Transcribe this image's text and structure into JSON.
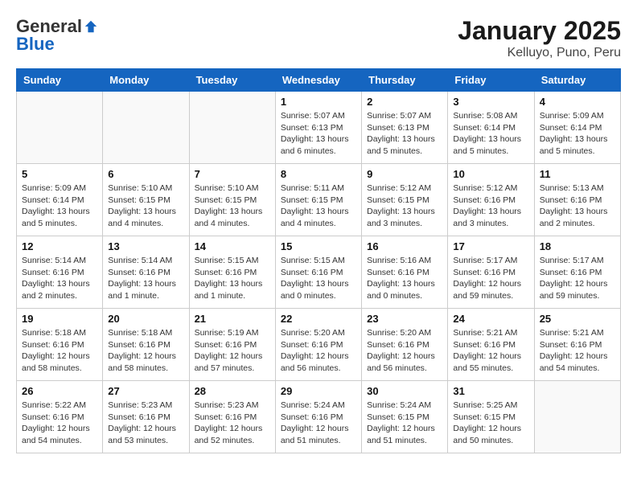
{
  "header": {
    "logo_general": "General",
    "logo_blue": "Blue",
    "month_title": "January 2025",
    "location": "Kelluyo, Puno, Peru"
  },
  "weekdays": [
    "Sunday",
    "Monday",
    "Tuesday",
    "Wednesday",
    "Thursday",
    "Friday",
    "Saturday"
  ],
  "weeks": [
    [
      {
        "day": "",
        "info": ""
      },
      {
        "day": "",
        "info": ""
      },
      {
        "day": "",
        "info": ""
      },
      {
        "day": "1",
        "info": "Sunrise: 5:07 AM\nSunset: 6:13 PM\nDaylight: 13 hours\nand 6 minutes."
      },
      {
        "day": "2",
        "info": "Sunrise: 5:07 AM\nSunset: 6:13 PM\nDaylight: 13 hours\nand 5 minutes."
      },
      {
        "day": "3",
        "info": "Sunrise: 5:08 AM\nSunset: 6:14 PM\nDaylight: 13 hours\nand 5 minutes."
      },
      {
        "day": "4",
        "info": "Sunrise: 5:09 AM\nSunset: 6:14 PM\nDaylight: 13 hours\nand 5 minutes."
      }
    ],
    [
      {
        "day": "5",
        "info": "Sunrise: 5:09 AM\nSunset: 6:14 PM\nDaylight: 13 hours\nand 5 minutes."
      },
      {
        "day": "6",
        "info": "Sunrise: 5:10 AM\nSunset: 6:15 PM\nDaylight: 13 hours\nand 4 minutes."
      },
      {
        "day": "7",
        "info": "Sunrise: 5:10 AM\nSunset: 6:15 PM\nDaylight: 13 hours\nand 4 minutes."
      },
      {
        "day": "8",
        "info": "Sunrise: 5:11 AM\nSunset: 6:15 PM\nDaylight: 13 hours\nand 4 minutes."
      },
      {
        "day": "9",
        "info": "Sunrise: 5:12 AM\nSunset: 6:15 PM\nDaylight: 13 hours\nand 3 minutes."
      },
      {
        "day": "10",
        "info": "Sunrise: 5:12 AM\nSunset: 6:16 PM\nDaylight: 13 hours\nand 3 minutes."
      },
      {
        "day": "11",
        "info": "Sunrise: 5:13 AM\nSunset: 6:16 PM\nDaylight: 13 hours\nand 2 minutes."
      }
    ],
    [
      {
        "day": "12",
        "info": "Sunrise: 5:14 AM\nSunset: 6:16 PM\nDaylight: 13 hours\nand 2 minutes."
      },
      {
        "day": "13",
        "info": "Sunrise: 5:14 AM\nSunset: 6:16 PM\nDaylight: 13 hours\nand 1 minute."
      },
      {
        "day": "14",
        "info": "Sunrise: 5:15 AM\nSunset: 6:16 PM\nDaylight: 13 hours\nand 1 minute."
      },
      {
        "day": "15",
        "info": "Sunrise: 5:15 AM\nSunset: 6:16 PM\nDaylight: 13 hours\nand 0 minutes."
      },
      {
        "day": "16",
        "info": "Sunrise: 5:16 AM\nSunset: 6:16 PM\nDaylight: 13 hours\nand 0 minutes."
      },
      {
        "day": "17",
        "info": "Sunrise: 5:17 AM\nSunset: 6:16 PM\nDaylight: 12 hours\nand 59 minutes."
      },
      {
        "day": "18",
        "info": "Sunrise: 5:17 AM\nSunset: 6:16 PM\nDaylight: 12 hours\nand 59 minutes."
      }
    ],
    [
      {
        "day": "19",
        "info": "Sunrise: 5:18 AM\nSunset: 6:16 PM\nDaylight: 12 hours\nand 58 minutes."
      },
      {
        "day": "20",
        "info": "Sunrise: 5:18 AM\nSunset: 6:16 PM\nDaylight: 12 hours\nand 58 minutes."
      },
      {
        "day": "21",
        "info": "Sunrise: 5:19 AM\nSunset: 6:16 PM\nDaylight: 12 hours\nand 57 minutes."
      },
      {
        "day": "22",
        "info": "Sunrise: 5:20 AM\nSunset: 6:16 PM\nDaylight: 12 hours\nand 56 minutes."
      },
      {
        "day": "23",
        "info": "Sunrise: 5:20 AM\nSunset: 6:16 PM\nDaylight: 12 hours\nand 56 minutes."
      },
      {
        "day": "24",
        "info": "Sunrise: 5:21 AM\nSunset: 6:16 PM\nDaylight: 12 hours\nand 55 minutes."
      },
      {
        "day": "25",
        "info": "Sunrise: 5:21 AM\nSunset: 6:16 PM\nDaylight: 12 hours\nand 54 minutes."
      }
    ],
    [
      {
        "day": "26",
        "info": "Sunrise: 5:22 AM\nSunset: 6:16 PM\nDaylight: 12 hours\nand 54 minutes."
      },
      {
        "day": "27",
        "info": "Sunrise: 5:23 AM\nSunset: 6:16 PM\nDaylight: 12 hours\nand 53 minutes."
      },
      {
        "day": "28",
        "info": "Sunrise: 5:23 AM\nSunset: 6:16 PM\nDaylight: 12 hours\nand 52 minutes."
      },
      {
        "day": "29",
        "info": "Sunrise: 5:24 AM\nSunset: 6:16 PM\nDaylight: 12 hours\nand 51 minutes."
      },
      {
        "day": "30",
        "info": "Sunrise: 5:24 AM\nSunset: 6:15 PM\nDaylight: 12 hours\nand 51 minutes."
      },
      {
        "day": "31",
        "info": "Sunrise: 5:25 AM\nSunset: 6:15 PM\nDaylight: 12 hours\nand 50 minutes."
      },
      {
        "day": "",
        "info": ""
      }
    ]
  ]
}
